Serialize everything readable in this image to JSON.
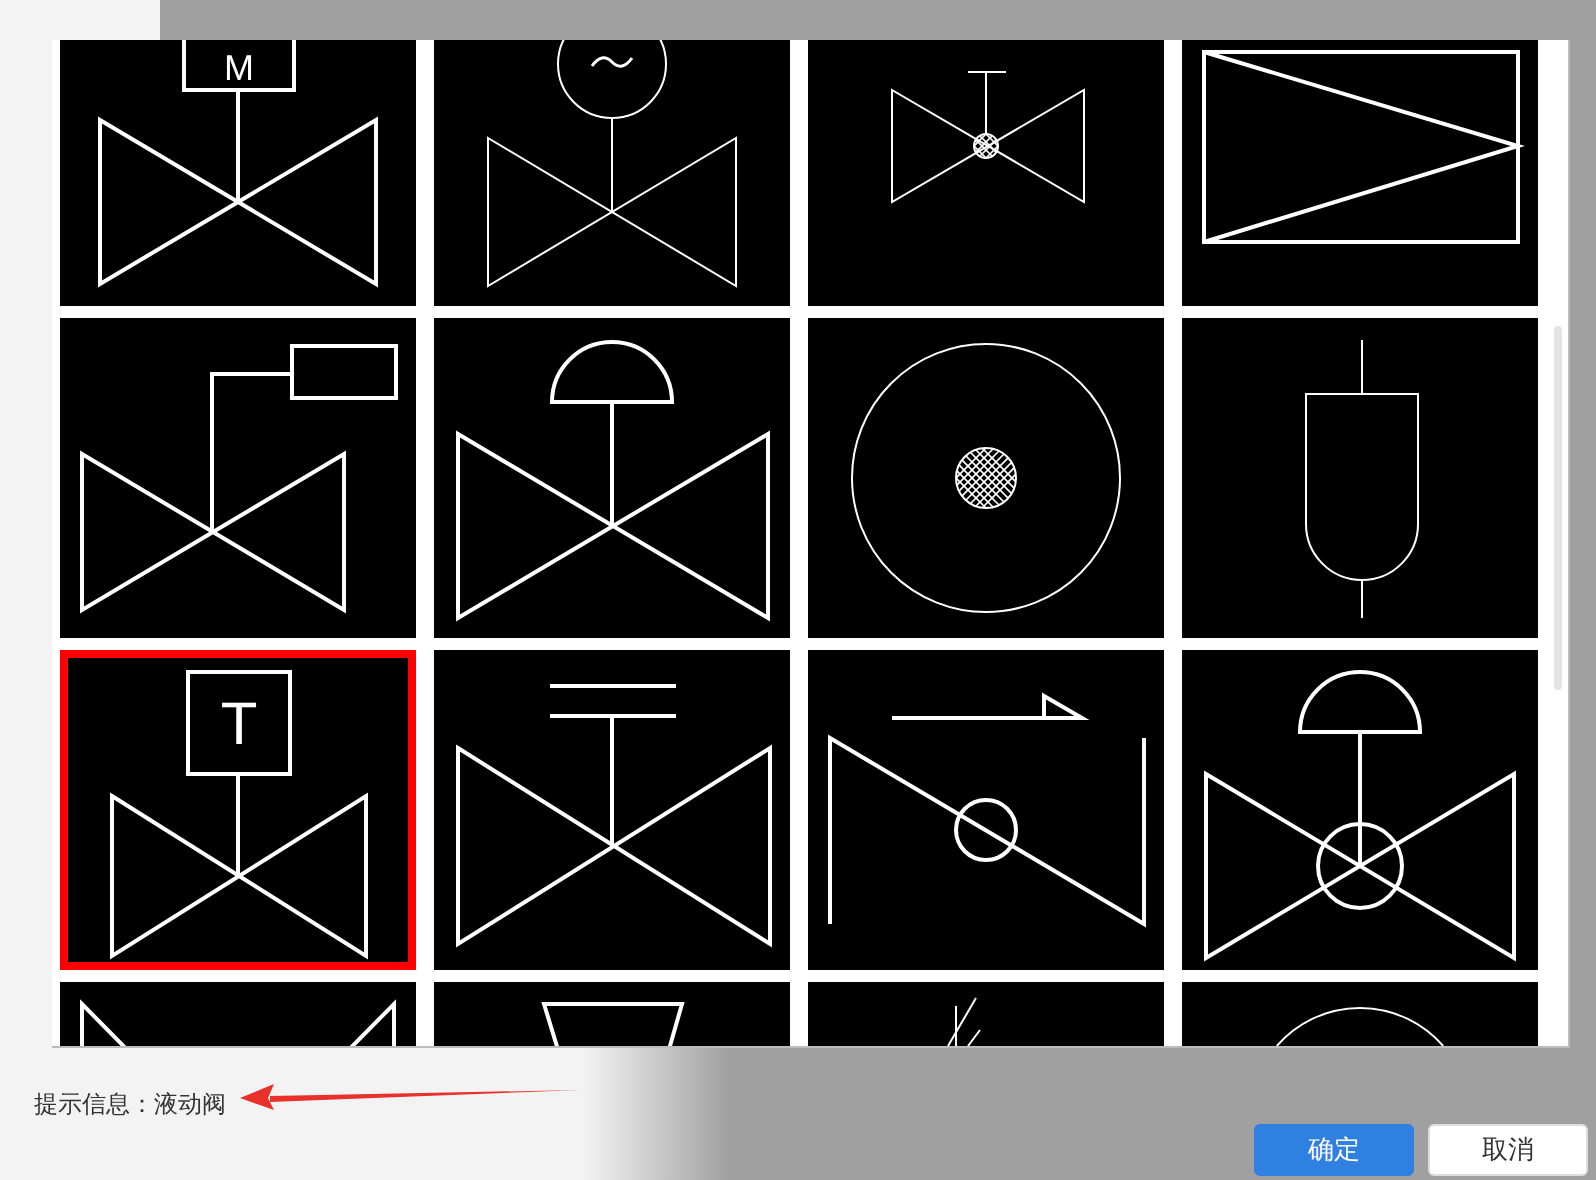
{
  "symbol_grid": {
    "tiles": [
      {
        "kind": "motor",
        "label": "M",
        "selected": false
      },
      {
        "kind": "electric",
        "selected": false
      },
      {
        "kind": "ball-stem",
        "selected": false
      },
      {
        "kind": "reducer",
        "selected": false
      },
      {
        "kind": "box-actuator",
        "selected": false
      },
      {
        "kind": "diaphragm",
        "selected": false
      },
      {
        "kind": "ball-circle",
        "selected": false
      },
      {
        "kind": "capsule",
        "selected": false
      },
      {
        "kind": "labeled-box",
        "label": "T",
        "selected": true
      },
      {
        "kind": "double-bar",
        "selected": false
      },
      {
        "kind": "check-circle",
        "selected": false
      },
      {
        "kind": "dome-ball",
        "selected": false
      },
      {
        "kind": "bowtie",
        "selected": false
      },
      {
        "kind": "funnel",
        "selected": false
      },
      {
        "kind": "sketch",
        "selected": false
      },
      {
        "kind": "arc",
        "selected": false
      }
    ]
  },
  "hint": "提示信息：液动阀",
  "buttons": [
    {
      "label": "确定",
      "kind": "primary"
    },
    {
      "label": "取消",
      "kind": "default"
    }
  ]
}
